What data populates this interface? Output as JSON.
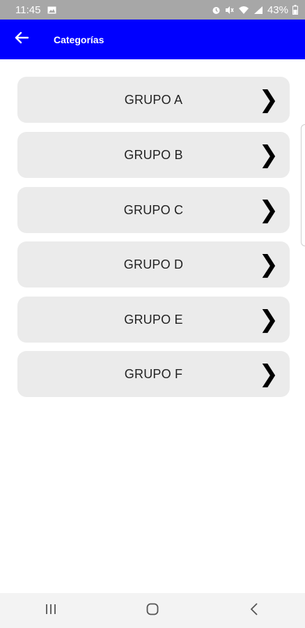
{
  "status_bar": {
    "time": "11:45",
    "battery": "43%",
    "icons": [
      "image-icon",
      "alarm-icon",
      "mute-icon",
      "wifi-icon",
      "signal-icon",
      "battery-icon"
    ]
  },
  "app_bar": {
    "title": "Categorías",
    "back_icon": "arrow-left-icon",
    "color": "#0000ff"
  },
  "groups": [
    {
      "label": "GRUPO A"
    },
    {
      "label": "GRUPO B"
    },
    {
      "label": "GRUPO C"
    },
    {
      "label": "GRUPO D"
    },
    {
      "label": "GRUPO E"
    },
    {
      "label": "GRUPO F"
    }
  ],
  "chevron": "❯",
  "nav_bar": {
    "buttons": [
      "recent-apps-icon",
      "home-icon",
      "back-icon"
    ]
  }
}
